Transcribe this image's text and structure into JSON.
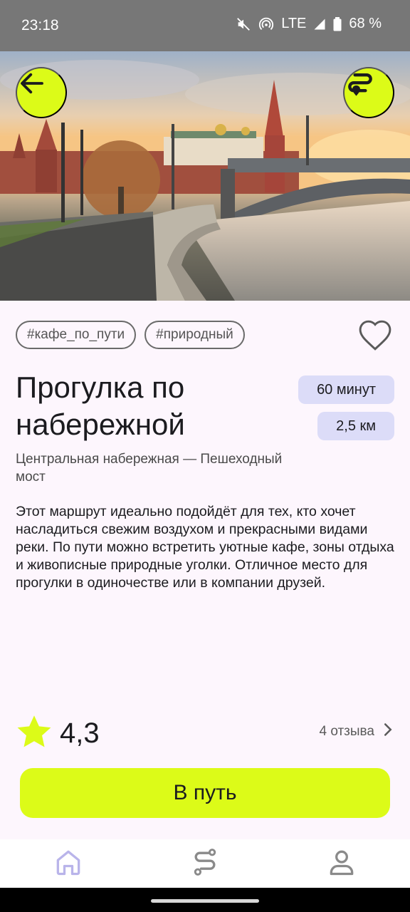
{
  "status_bar": {
    "time": "23:18",
    "network": "LTE",
    "battery": "68 %"
  },
  "hero": {
    "image_description": "Moscow Kremlin embankment at sunrise"
  },
  "tags": [
    "#кафе_по_пути",
    "#природный"
  ],
  "route": {
    "title": "Прогулка по набережной",
    "duration": "60 минут",
    "distance": "2,5 км",
    "subtitle": "Центральная набережная — Пешеходный мост",
    "description": "Этот маршрут идеально подойдёт для тех, кто хочет насладиться свежим воздухом и прекрасными видами реки. По пути можно встретить уютные кафе, зоны отдыха и живописные природные уголки. Отличное место для прогулки в одиночестве или в компании друзей."
  },
  "rating": {
    "value": "4,3",
    "reviews_label": "4 отзыва"
  },
  "actions": {
    "go_label": "В путь"
  },
  "nav": {
    "items": [
      "home-icon",
      "routes-icon",
      "profile-icon"
    ]
  },
  "colors": {
    "accent": "#dcfb18",
    "chip_bg": "#dcdcf8",
    "background": "#fdf6fd"
  }
}
